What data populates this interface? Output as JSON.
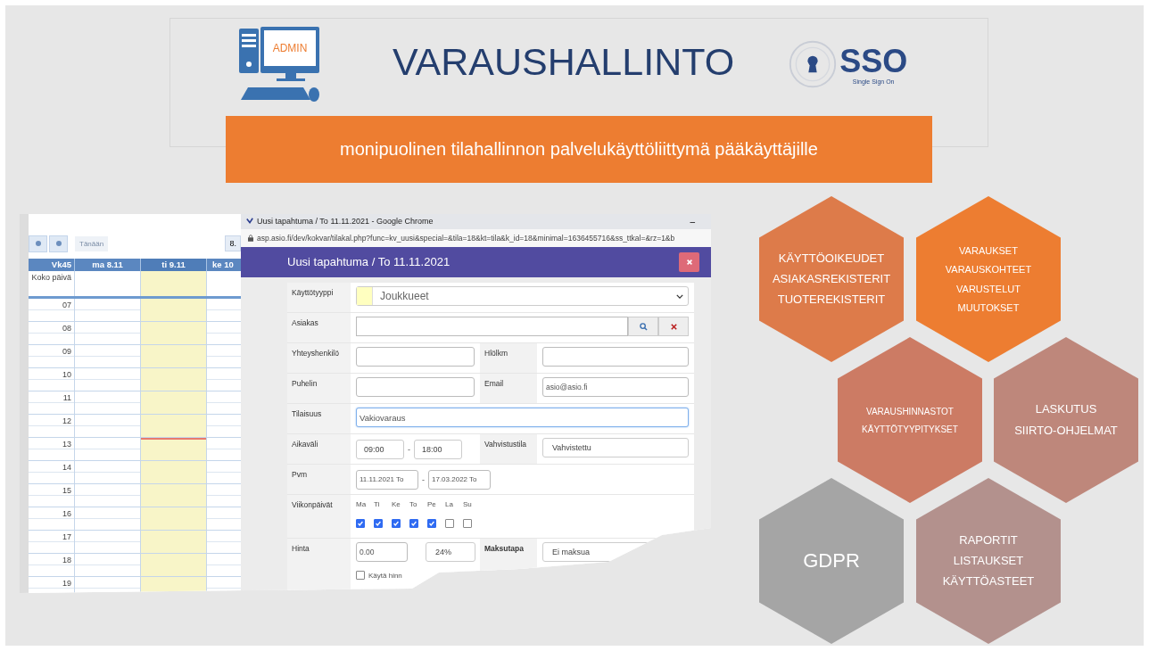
{
  "header": {
    "logo_badge": "ADMIN",
    "title": "VARAUSHALLINTO",
    "sso": {
      "title": "SSO",
      "subtitle": "Single Sign On"
    }
  },
  "banner": "monipuolinen tilahallinnon palvelukäyttöliittymä pääkäyttäjille",
  "calendar": {
    "today_button": "Tänään",
    "date_button": "8.",
    "columns": [
      {
        "label": "Vk45",
        "selected": false
      },
      {
        "label": "ma 8.11",
        "selected": false
      },
      {
        "label": "ti 9.11",
        "selected": true
      },
      {
        "label": "ke 10",
        "selected": false
      }
    ],
    "all_day": "Koko päivä",
    "hours": [
      "07",
      "08",
      "09",
      "10",
      "11",
      "12",
      "13",
      "14",
      "15",
      "16",
      "17",
      "18",
      "19"
    ]
  },
  "browser": {
    "title": "Uusi tapahtuma / To 11.11.2021 - Google Chrome",
    "minimize": "–",
    "url": "asp.asio.fi/dev/kokvar/tilakal.php?func=kv_uusi&special=&tila=18&kt=tila&k_id=18&minimal=1636455716&ss_ttkal=&rz=1&b"
  },
  "dialog": {
    "title": "Uusi tapahtuma / To 11.11.2021",
    "rows": [
      {
        "kind": "color-select",
        "label": "Käyttötyyppi",
        "value": "Joukkueet"
      },
      {
        "kind": "search",
        "label": "Asiakas"
      },
      {
        "kind": "pair",
        "fields": [
          {
            "label": "Yhteyshenkilö"
          },
          {
            "label": "Hlölkm"
          }
        ]
      },
      {
        "kind": "pair",
        "fields": [
          {
            "label": "Puhelin"
          },
          {
            "label": "Email",
            "value": "asio@asio.fi"
          }
        ]
      },
      {
        "kind": "text",
        "label": "Tilaisuus",
        "value": "Vakiovaraus",
        "focused": true
      },
      {
        "kind": "time",
        "label": "Aikaväli",
        "from": "09:00",
        "separator": "-",
        "to": "18:00",
        "label2": "Vahvistustila",
        "status": "Vahvistettu"
      },
      {
        "kind": "dates",
        "label": "Pvm",
        "from": "11.11.2021 To",
        "separator": "-",
        "to": "17.03.2022 To"
      },
      {
        "kind": "weekdays",
        "label": "Viikonpäivät",
        "days": [
          {
            "label": "Ma",
            "checked": true
          },
          {
            "label": "Ti",
            "checked": true
          },
          {
            "label": "Ke",
            "checked": true
          },
          {
            "label": "To",
            "checked": true
          },
          {
            "label": "Pe",
            "checked": true
          },
          {
            "label": "La",
            "checked": false
          },
          {
            "label": "Su",
            "checked": false
          }
        ]
      },
      {
        "kind": "price",
        "label": "Hinta",
        "price": "0.00",
        "vat": "24%",
        "label2": "Maksutapa",
        "payment": "Ei maksua",
        "option": {
          "label": "Käytä hinn",
          "checked": false
        }
      }
    ]
  },
  "hexagons": [
    {
      "lines": [
        "KÄYTTÖOIKEUDET",
        "ASIAKASREKISTERIT",
        "TUOTEREKISTERIT"
      ],
      "color": "#dd7b4a"
    },
    {
      "lines": [
        "VARAUKSET",
        "VARAUSKOHTEET",
        "VARUSTELUT",
        "MUUTOKSET"
      ],
      "color": "#ed7d31"
    },
    {
      "lines": [
        "VARAUSHINNASTOT",
        "KÄYTTÖTYYPITYKSET"
      ],
      "color": "#cc7b64"
    },
    {
      "lines": [
        "LASKUTUS",
        "SIIRTO-OHJELMAT"
      ],
      "color": "#be877b"
    },
    {
      "lines": [
        "GDPR"
      ],
      "color": "#a5a5a5"
    },
    {
      "lines": [
        "RAPORTIT",
        "LISTAUKSET",
        "KÄYTTÖASTEET"
      ],
      "color": "#b3918d"
    }
  ]
}
